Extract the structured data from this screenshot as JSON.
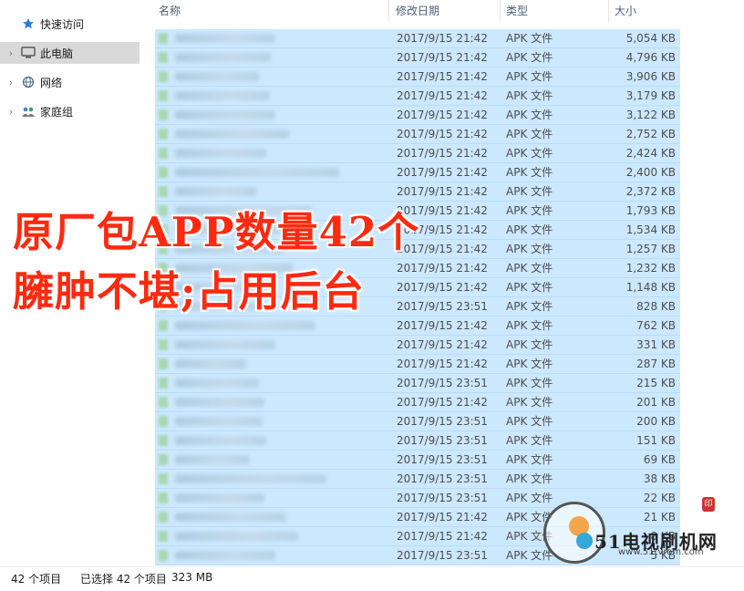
{
  "nav": {
    "items": [
      {
        "label": "快速访问",
        "icon": "star-icon"
      },
      {
        "label": "此电脑",
        "icon": "computer-icon"
      },
      {
        "label": "网络",
        "icon": "network-icon"
      },
      {
        "label": "家庭组",
        "icon": "homegroup-icon"
      }
    ]
  },
  "header": {
    "name": "名称",
    "date": "修改日期",
    "type": "类型",
    "size": "大小"
  },
  "rows": [
    {
      "date": "2017/9/15 21:42",
      "type": "APK 文件",
      "size": "5,054 KB"
    },
    {
      "date": "2017/9/15 21:42",
      "type": "APK 文件",
      "size": "4,796 KB"
    },
    {
      "date": "2017/9/15 21:42",
      "type": "APK 文件",
      "size": "3,906 KB"
    },
    {
      "date": "2017/9/15 21:42",
      "type": "APK 文件",
      "size": "3,179 KB"
    },
    {
      "date": "2017/9/15 21:42",
      "type": "APK 文件",
      "size": "3,122 KB"
    },
    {
      "date": "2017/9/15 21:42",
      "type": "APK 文件",
      "size": "2,752 KB"
    },
    {
      "date": "2017/9/15 21:42",
      "type": "APK 文件",
      "size": "2,424 KB"
    },
    {
      "date": "2017/9/15 21:42",
      "type": "APK 文件",
      "size": "2,400 KB"
    },
    {
      "date": "2017/9/15 21:42",
      "type": "APK 文件",
      "size": "2,372 KB"
    },
    {
      "date": "2017/9/15 21:42",
      "type": "APK 文件",
      "size": "1,793 KB"
    },
    {
      "date": "2017/9/15 21:42",
      "type": "APK 文件",
      "size": "1,534 KB"
    },
    {
      "date": "2017/9/15 21:42",
      "type": "APK 文件",
      "size": "1,257 KB"
    },
    {
      "date": "2017/9/15 21:42",
      "type": "APK 文件",
      "size": "1,232 KB"
    },
    {
      "date": "2017/9/15 21:42",
      "type": "APK 文件",
      "size": "1,148 KB"
    },
    {
      "date": "2017/9/15 23:51",
      "type": "APK 文件",
      "size": "828 KB"
    },
    {
      "date": "2017/9/15 21:42",
      "type": "APK 文件",
      "size": "762 KB"
    },
    {
      "date": "2017/9/15 21:42",
      "type": "APK 文件",
      "size": "331 KB"
    },
    {
      "date": "2017/9/15 21:42",
      "type": "APK 文件",
      "size": "287 KB"
    },
    {
      "date": "2017/9/15 23:51",
      "type": "APK 文件",
      "size": "215 KB"
    },
    {
      "date": "2017/9/15 21:42",
      "type": "APK 文件",
      "size": "201 KB"
    },
    {
      "date": "2017/9/15 23:51",
      "type": "APK 文件",
      "size": "200 KB"
    },
    {
      "date": "2017/9/15 23:51",
      "type": "APK 文件",
      "size": "151 KB"
    },
    {
      "date": "2017/9/15 23:51",
      "type": "APK 文件",
      "size": "69 KB"
    },
    {
      "date": "2017/9/15 23:51",
      "type": "APK 文件",
      "size": "38 KB"
    },
    {
      "date": "2017/9/15 23:51",
      "type": "APK 文件",
      "size": "22 KB"
    },
    {
      "date": "2017/9/15 21:42",
      "type": "APK 文件",
      "size": "21 KB"
    },
    {
      "date": "2017/9/15 21:42",
      "type": "APK 文件",
      "size": "8 KB"
    },
    {
      "date": "2017/9/15 23:51",
      "type": "APK 文件",
      "size": "5 KB"
    }
  ],
  "overlay": {
    "line1": "原厂包APP数量42个",
    "line2": "臃肿不堪;占用后台"
  },
  "status": {
    "count": "42 个项目",
    "selected": "已选择 42 个项目",
    "total": "323 MB"
  },
  "watermark": {
    "brand": "51电视刷机网",
    "url": "www.51tvrom.com"
  },
  "colors": {
    "selection": "#cce8ff",
    "overlay_text": "#ff2a10"
  }
}
